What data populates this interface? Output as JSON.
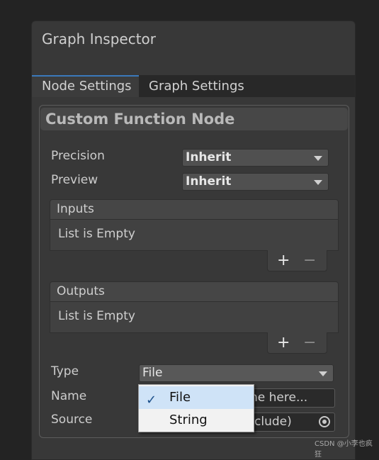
{
  "window": {
    "title": "Graph Inspector"
  },
  "tabs": [
    {
      "label": "Node Settings",
      "active": true
    },
    {
      "label": "Graph Settings",
      "active": false
    }
  ],
  "node": {
    "title": "Custom Function Node"
  },
  "precision": {
    "label": "Precision",
    "value": "Inherit"
  },
  "preview": {
    "label": "Preview",
    "value": "Inherit"
  },
  "inputs": {
    "header": "Inputs",
    "empty_text": "List is Empty",
    "add": "+",
    "remove": "−"
  },
  "outputs": {
    "header": "Outputs",
    "empty_text": "List is Empty",
    "add": "+",
    "remove": "−"
  },
  "type": {
    "label": "Type",
    "value": "File"
  },
  "name": {
    "label": "Name",
    "visible_value": "ne here..."
  },
  "source": {
    "label": "Source",
    "visible_value": "clude)"
  },
  "dropdown_menu": {
    "items": [
      {
        "label": "File",
        "checked": true
      },
      {
        "label": "String",
        "checked": false
      }
    ],
    "check_glyph": "✓"
  },
  "watermark": "CSDN @小李也疯狂",
  "colors": {
    "accent_tab": "#3a79bb",
    "menu_selected": "#cfe3f7"
  }
}
